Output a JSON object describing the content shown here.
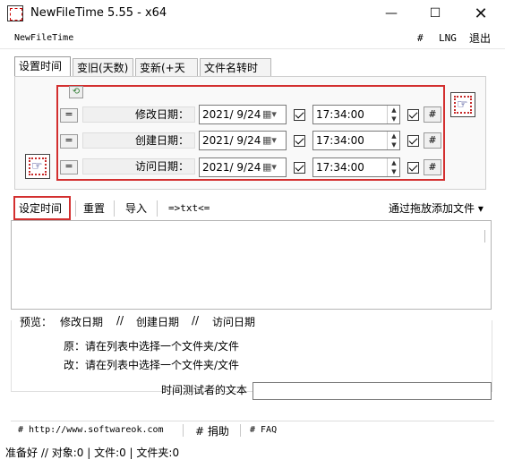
{
  "window": {
    "title": "NewFileTime 5.55 - x64"
  },
  "menu": {
    "app_name": "NewFileTime",
    "hash": "#",
    "lng": "LNG",
    "exit": "退出"
  },
  "tabs": [
    {
      "label": "设置时间",
      "active": true
    },
    {
      "label": "变旧(天数)"
    },
    {
      "label": "变新(+天数)"
    },
    {
      "label": "文件名转时间"
    }
  ],
  "rows": [
    {
      "eq": "=",
      "label": "修改日期：",
      "date": "2021/ 9/24",
      "time": "17:34:00",
      "hash": "#"
    },
    {
      "eq": "=",
      "label": "创建日期：",
      "date": "2021/ 9/24",
      "time": "17:34:00",
      "hash": "#"
    },
    {
      "eq": "=",
      "label": "访问日期：",
      "date": "2021/ 9/24",
      "time": "17:34:00",
      "hash": "#"
    }
  ],
  "toolbar": {
    "set_time": "设定时间",
    "reset": "重置",
    "import": "导入",
    "txt": "=>txt<=",
    "drag_add": "通过拖放添加文件 ▾"
  },
  "preview": {
    "label": "预览：",
    "modify": "修改日期",
    "sep1": "//",
    "create": "创建日期",
    "sep2": "//",
    "access": "访问日期",
    "orig": "原：请在列表中选择一个文件夹/文件",
    "changed": "改：请在列表中选择一个文件夹/文件",
    "tester_label": "时间测试者的文本"
  },
  "footer": {
    "url": "# http://www.softwareok.com",
    "donate": "# 捐助",
    "faq": "# FAQ"
  },
  "status": "准备好 // 对象:0 | 文件:0  | 文件夹:0",
  "colors": {
    "highlight": "#d32f2f"
  }
}
